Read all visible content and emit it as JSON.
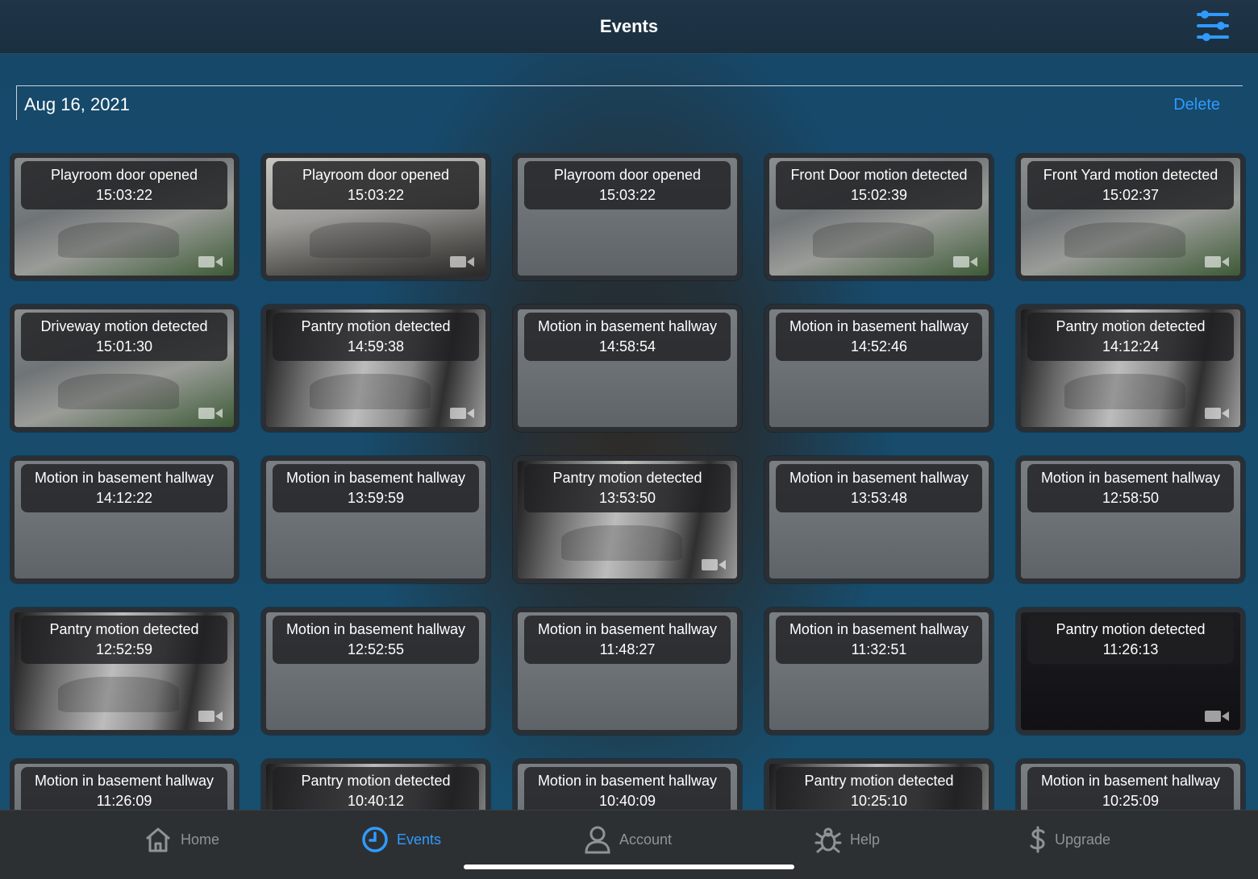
{
  "header": {
    "title": "Events",
    "filter_icon": "sliders-icon"
  },
  "date_section": {
    "date": "Aug 16, 2021",
    "delete_label": "Delete"
  },
  "events": [
    {
      "title": "Playroom door opened",
      "time": "15:03:22",
      "thumb": "outdoor",
      "has_video": true
    },
    {
      "title": "Playroom door opened",
      "time": "15:03:22",
      "thumb": "room",
      "has_video": true
    },
    {
      "title": "Playroom door opened",
      "time": "15:03:22",
      "thumb": "none",
      "has_video": false
    },
    {
      "title": "Front Door motion detected",
      "time": "15:02:39",
      "thumb": "outdoor",
      "has_video": true
    },
    {
      "title": "Front Yard motion detected",
      "time": "15:02:37",
      "thumb": "outdoor",
      "has_video": true
    },
    {
      "title": "Driveway motion detected",
      "time": "15:01:30",
      "thumb": "outdoor",
      "has_video": true
    },
    {
      "title": "Pantry motion detected",
      "time": "14:59:38",
      "thumb": "pantry",
      "has_video": true
    },
    {
      "title": "Motion in basement hallway",
      "time": "14:58:54",
      "thumb": "none",
      "has_video": false
    },
    {
      "title": "Motion in basement hallway",
      "time": "14:52:46",
      "thumb": "none",
      "has_video": false
    },
    {
      "title": "Pantry motion detected",
      "time": "14:12:24",
      "thumb": "pantry",
      "has_video": true
    },
    {
      "title": "Motion in basement hallway",
      "time": "14:12:22",
      "thumb": "none",
      "has_video": false
    },
    {
      "title": "Motion in basement hallway",
      "time": "13:59:59",
      "thumb": "none",
      "has_video": false
    },
    {
      "title": "Pantry motion detected",
      "time": "13:53:50",
      "thumb": "pantry",
      "has_video": true
    },
    {
      "title": "Motion in basement hallway",
      "time": "13:53:48",
      "thumb": "none",
      "has_video": false
    },
    {
      "title": "Motion in basement hallway",
      "time": "12:58:50",
      "thumb": "none",
      "has_video": false
    },
    {
      "title": "Pantry motion detected",
      "time": "12:52:59",
      "thumb": "pantry",
      "has_video": true
    },
    {
      "title": "Motion in basement hallway",
      "time": "12:52:55",
      "thumb": "none",
      "has_video": false
    },
    {
      "title": "Motion in basement hallway",
      "time": "11:48:27",
      "thumb": "none",
      "has_video": false
    },
    {
      "title": "Motion in basement hallway",
      "time": "11:32:51",
      "thumb": "none",
      "has_video": false
    },
    {
      "title": "Pantry motion detected",
      "time": "11:26:13",
      "thumb": "night",
      "has_video": true
    },
    {
      "title": "Motion in basement hallway",
      "time": "11:26:09",
      "thumb": "none",
      "has_video": false
    },
    {
      "title": "Pantry motion detected",
      "time": "10:40:12",
      "thumb": "pantry",
      "has_video": true
    },
    {
      "title": "Motion in basement hallway",
      "time": "10:40:09",
      "thumb": "none",
      "has_video": false
    },
    {
      "title": "Pantry motion detected",
      "time": "10:25:10",
      "thumb": "pantry",
      "has_video": true
    },
    {
      "title": "Motion in basement hallway",
      "time": "10:25:09",
      "thumb": "none",
      "has_video": false
    }
  ],
  "tabs": [
    {
      "label": "Home",
      "icon": "home-icon",
      "active": false
    },
    {
      "label": "Events",
      "icon": "clock-icon",
      "active": true
    },
    {
      "label": "Account",
      "icon": "person-icon",
      "active": false
    },
    {
      "label": "Help",
      "icon": "bug-icon",
      "active": false
    },
    {
      "label": "Upgrade",
      "icon": "dollar-icon",
      "active": false
    }
  ],
  "colors": {
    "accent": "#2f9bff",
    "inactive_tab": "#8f9396"
  }
}
